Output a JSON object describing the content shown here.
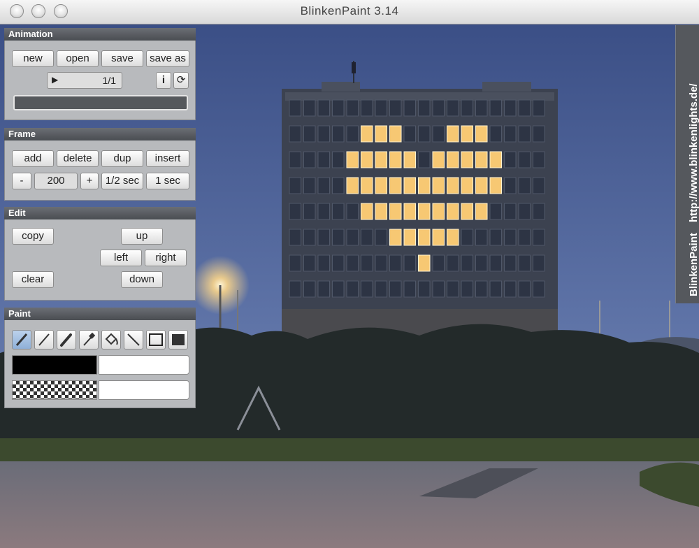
{
  "window": {
    "title": "BlinkenPaint 3.14"
  },
  "side_tab": {
    "url": "http://www.blinkenlights.de/",
    "name": "BlinkenPaint"
  },
  "animation": {
    "header": "Animation",
    "buttons": {
      "new": "new",
      "open": "open",
      "save": "save",
      "save_as": "save as"
    },
    "frame_counter": "1/1",
    "info_label": "i"
  },
  "frame": {
    "header": "Frame",
    "buttons": {
      "add": "add",
      "delete": "delete",
      "dup": "dup",
      "insert": "insert"
    },
    "minus": "-",
    "duration": "200",
    "plus": "+",
    "half_sec": "1/2 sec",
    "one_sec": "1 sec"
  },
  "edit": {
    "header": "Edit",
    "buttons": {
      "copy": "copy",
      "clear": "clear",
      "up": "up",
      "left": "left",
      "right": "right",
      "down": "down"
    }
  },
  "paint": {
    "header": "Paint",
    "tools": [
      "pen-icon",
      "pencil-icon",
      "brush-icon",
      "eyedropper-icon",
      "fill-bucket-icon",
      "line-icon",
      "rectangle-outline-icon",
      "rectangle-filled-icon"
    ],
    "colors": {
      "foreground": "#000000",
      "background": "#ffffff"
    }
  },
  "building": {
    "lit_color": "#f7c873",
    "rows": 8,
    "cols": 18,
    "lit": [
      [
        1,
        5
      ],
      [
        1,
        6
      ],
      [
        1,
        7
      ],
      [
        1,
        11
      ],
      [
        1,
        12
      ],
      [
        1,
        13
      ],
      [
        2,
        4
      ],
      [
        2,
        5
      ],
      [
        2,
        6
      ],
      [
        2,
        7
      ],
      [
        2,
        8
      ],
      [
        2,
        10
      ],
      [
        2,
        11
      ],
      [
        2,
        12
      ],
      [
        2,
        13
      ],
      [
        2,
        14
      ],
      [
        3,
        4
      ],
      [
        3,
        5
      ],
      [
        3,
        6
      ],
      [
        3,
        7
      ],
      [
        3,
        8
      ],
      [
        3,
        9
      ],
      [
        3,
        10
      ],
      [
        3,
        11
      ],
      [
        3,
        12
      ],
      [
        3,
        13
      ],
      [
        3,
        14
      ],
      [
        4,
        5
      ],
      [
        4,
        6
      ],
      [
        4,
        7
      ],
      [
        4,
        8
      ],
      [
        4,
        9
      ],
      [
        4,
        10
      ],
      [
        4,
        11
      ],
      [
        4,
        12
      ],
      [
        4,
        13
      ],
      [
        5,
        7
      ],
      [
        5,
        8
      ],
      [
        5,
        9
      ],
      [
        5,
        10
      ],
      [
        5,
        11
      ],
      [
        6,
        9
      ]
    ]
  }
}
